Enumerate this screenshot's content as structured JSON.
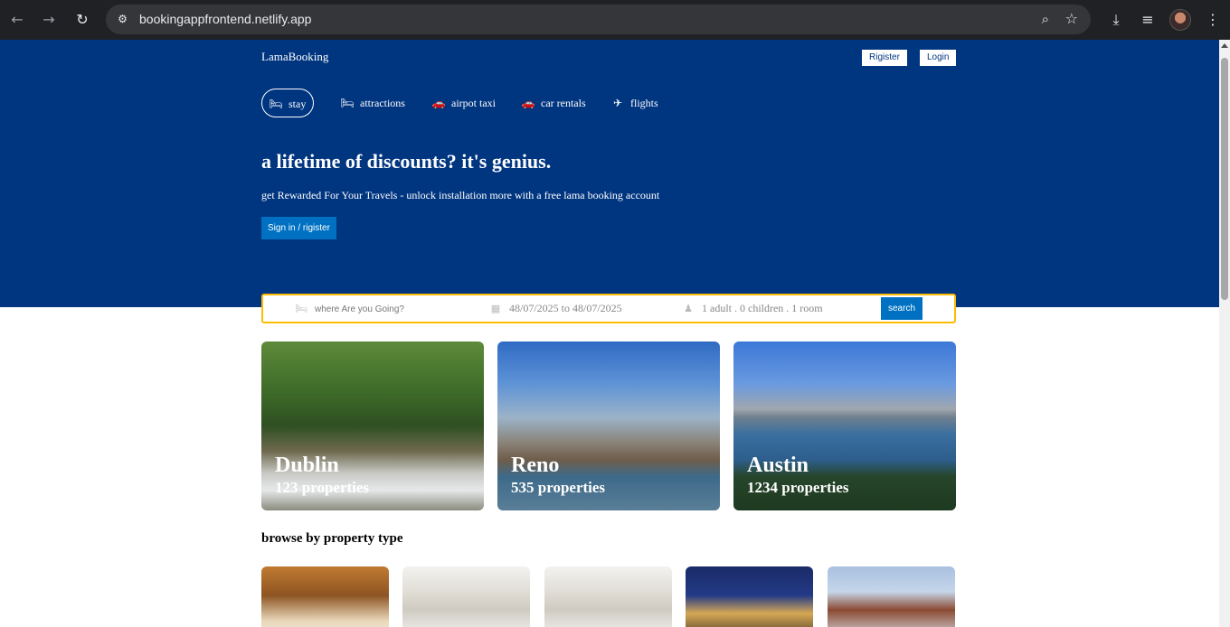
{
  "browser": {
    "url": "bookingappfrontend.netlify.app"
  },
  "header": {
    "logo": "LamaBooking",
    "register_label": "Rigister",
    "login_label": "Login"
  },
  "tabs": [
    {
      "label": "stay",
      "icon": "bed-icon",
      "active": true
    },
    {
      "label": "attractions",
      "icon": "bed-icon",
      "active": false
    },
    {
      "label": "airpot taxi",
      "icon": "car-icon",
      "active": false
    },
    {
      "label": "car rentals",
      "icon": "car-icon",
      "active": false
    },
    {
      "label": "flights",
      "icon": "plane-icon",
      "active": false
    }
  ],
  "hero": {
    "title": "a lifetime of discounts? it's genius.",
    "subtitle": "get Rewarded For Your Travels - unlock installation more with a free lama booking account",
    "signin_label": "Sign in / rigister"
  },
  "search": {
    "destination_placeholder": "where Are you Going?",
    "dates": "48/07/2025 to 48/07/2025",
    "options": "1 adult . 0 children . 1 room",
    "button_label": "search"
  },
  "featured": [
    {
      "city": "Dublin",
      "properties": "123 properties"
    },
    {
      "city": "Reno",
      "properties": "535 properties"
    },
    {
      "city": "Austin",
      "properties": "1234 properties"
    }
  ],
  "property_section": {
    "title": "browse by property type"
  }
}
